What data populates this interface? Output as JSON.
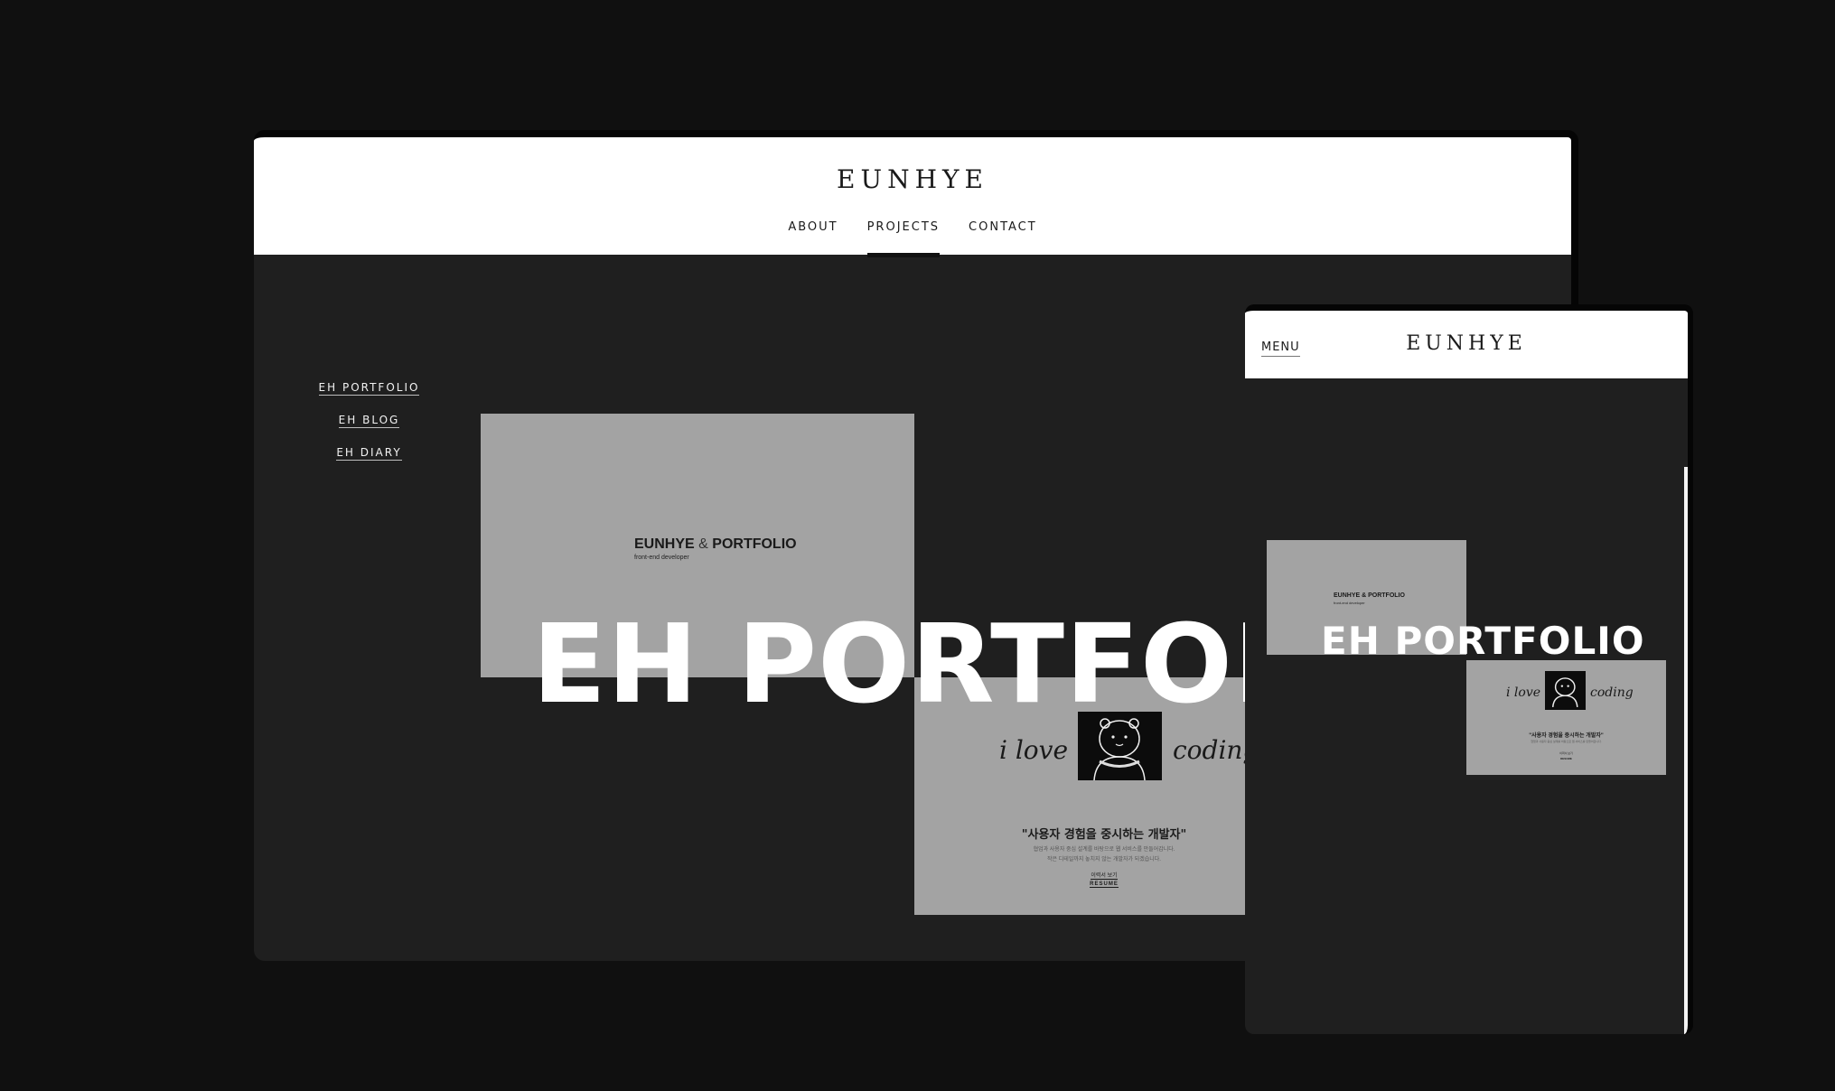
{
  "desktop": {
    "logo": "EUNHYE",
    "nav": [
      {
        "label": "ABOUT"
      },
      {
        "label": "PROJECTS",
        "active": true
      },
      {
        "label": "CONTACT"
      }
    ],
    "side_links": [
      "EH PORTFOLIO",
      "EH BLOG",
      "EH DIARY"
    ],
    "hero_title": "EH PORTFOLIO",
    "card1": {
      "brand_left": "EUNHYE",
      "brand_amp": "&",
      "brand_right": "PORTFOLIO",
      "subtitle": "front-end developer"
    },
    "card2": {
      "script_left": "i love",
      "script_right": "coding",
      "quote": "\"사용자 경험을 중시하는 개발자\"",
      "desc_line1": "협업과 사용자 중심 설계를 바탕으로 웹 서비스를 만들어갑니다.",
      "desc_line2": "작은 디테일까지 놓치지 않는 개발자가 되겠습니다.",
      "link1": "이력서 보기",
      "link2": "RESUME"
    }
  },
  "mobile": {
    "menu_label": "MENU",
    "logo": "EUNHYE",
    "hero_title": "EH PORTFOLIO",
    "card1": {
      "brand": "EUNHYE & PORTFOLIO",
      "subtitle": "front-end developer"
    },
    "card2": {
      "script_left": "i love",
      "script_right": "coding",
      "quote": "\"사용자 경험을 중시하는 개발자\"",
      "desc": "협업과 사용자 중심 설계를 바탕으로 웹 서비스를 만들어갑니다.",
      "link1": "이력서 보기",
      "link2": "RESUME"
    }
  },
  "colors": {
    "page_bg": "#101010",
    "screen_bg": "#1f1f1f",
    "header_bg": "#ffffff",
    "card_bg": "#a3a3a3",
    "hero_text": "#ffffff"
  }
}
